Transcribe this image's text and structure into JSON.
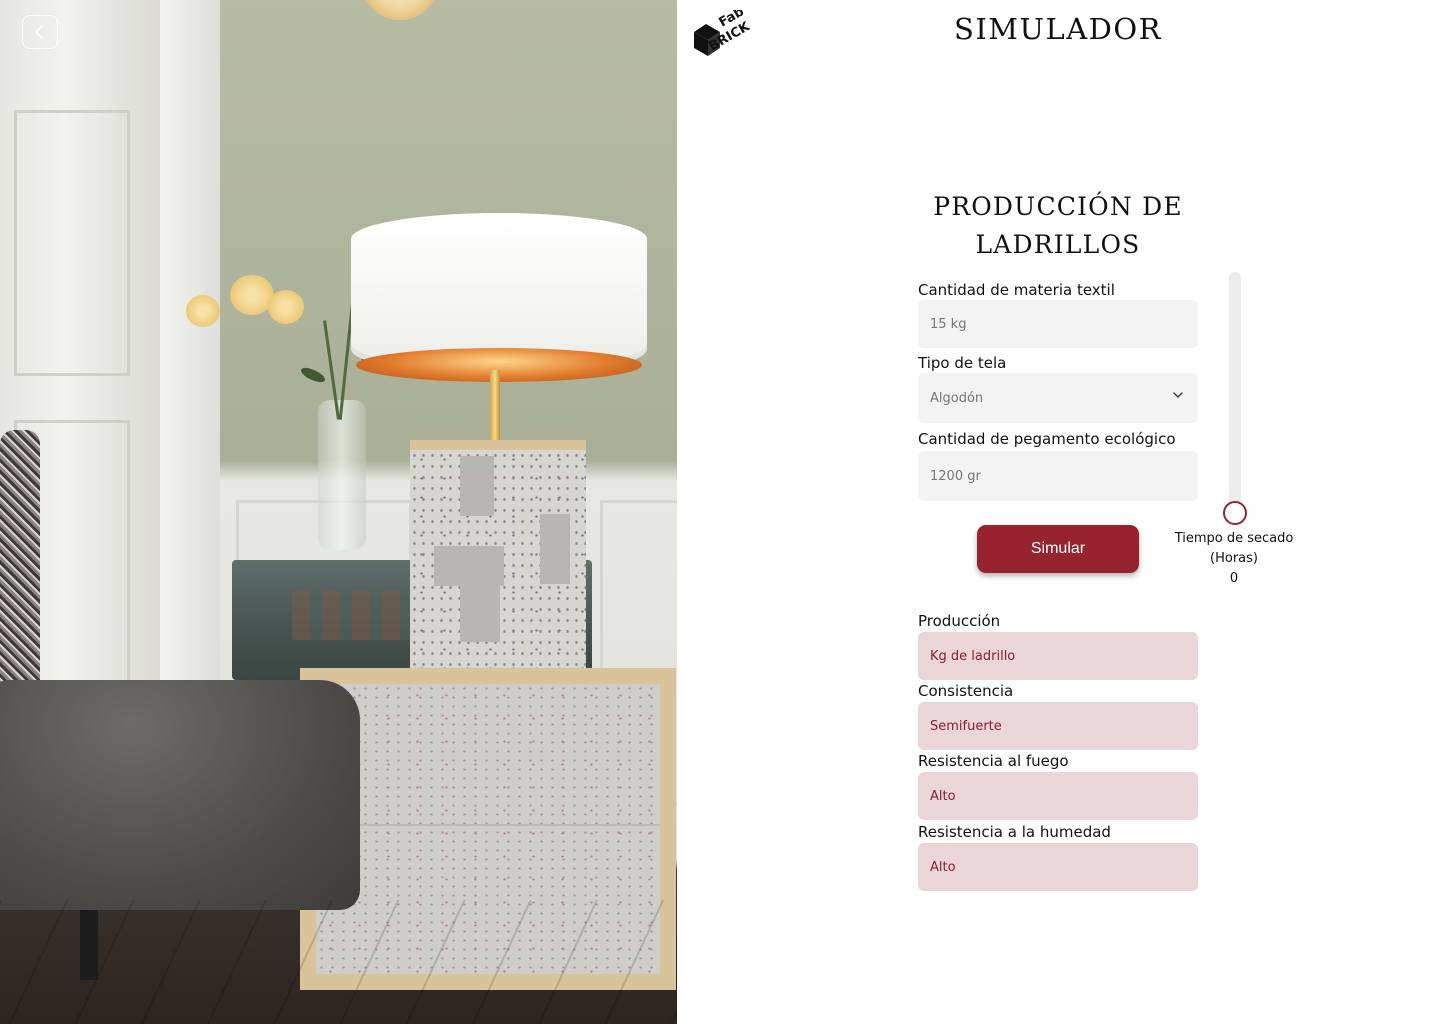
{
  "app": {
    "page_title": "SIMULADOR",
    "logo_text_top": "Fab",
    "logo_text_bottom": "BRICK"
  },
  "form": {
    "title_line1": "PRODUCCIÓN DE",
    "title_line2": "LADRILLOS",
    "textile_amount": {
      "label": "Cantidad de materia textil",
      "value": "15 kg"
    },
    "fabric_type": {
      "label": "Tipo de tela",
      "value": "Algodón"
    },
    "glue_amount": {
      "label": "Cantidad de pegamento ecológico",
      "value": "1200 gr"
    },
    "simulate_label": "Simular",
    "drying_time": {
      "label_line1": "Tiempo de secado",
      "label_line2": "(Horas)",
      "value": 0
    }
  },
  "results": [
    {
      "label": "Producción",
      "value": "Kg de ladrillo"
    },
    {
      "label": "Consistencia",
      "value": "Semifuerte"
    },
    {
      "label": "Resistencia al fuego",
      "value": "Alto"
    },
    {
      "label": "Resistencia a la humedad",
      "value": "Alto"
    }
  ],
  "colors": {
    "accent": "#96232d",
    "input_bg": "#f3f3f3",
    "result_bg": "#ead5d8",
    "result_text": "#8b1f2c"
  },
  "icons": {
    "back": "chevron-left-icon",
    "select": "chevron-down-icon"
  }
}
